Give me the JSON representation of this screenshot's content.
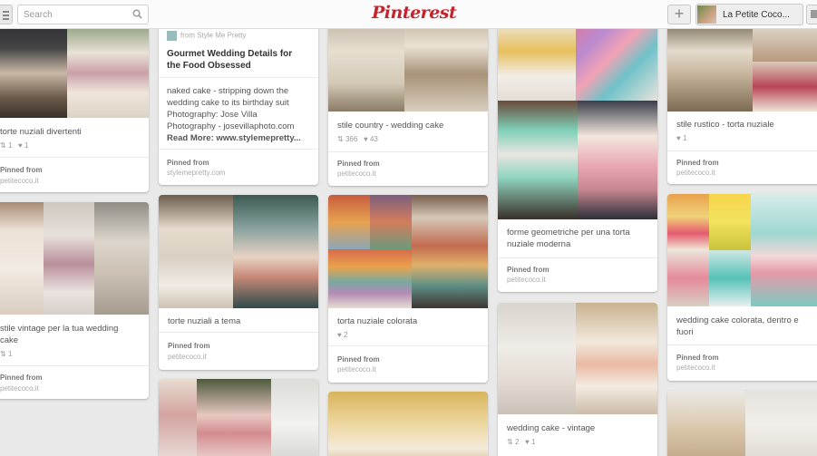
{
  "header": {
    "search_placeholder": "Search",
    "logo": "Pinterest",
    "add_label": "+",
    "user_name": "La Petite Coco..."
  },
  "pins": {
    "p1": {
      "desc": "torte nuziali divertenti",
      "repins": "1",
      "likes": "1",
      "pinned_label": "Pinned from",
      "source": "petitecoco.it"
    },
    "p2": {
      "desc": "stile vintage per la tua wedding",
      "desc2": "cake",
      "repins": "1",
      "pinned_label": "Pinned from",
      "source": "petitecoco.it"
    },
    "p3": {
      "via": "from Style Me Pretty",
      "title": "Gourmet Wedding Details for",
      "title2": "the Food Obsessed",
      "desc1": "naked cake - stripping down the",
      "desc2": "wedding cake to its birthday suit",
      "desc3": "Photography: Jose Villa",
      "desc4": "Photography - josevillaphoto.com",
      "desc5": "Read More: www.stylemepretty...",
      "pinned_label": "Pinned from",
      "source": "stylemepretty.com"
    },
    "p4": {
      "desc": "torte nuziali a tema",
      "pinned_label": "Pinned from",
      "source": "petitecoco.it"
    },
    "p5": {
      "desc": "stile country - wedding cake",
      "repins": "366",
      "likes": "43",
      "pinned_label": "Pinned from",
      "source": "petitecoco.it"
    },
    "p6": {
      "desc": "torta nuziale colorata",
      "likes": "2",
      "pinned_label": "Pinned from",
      "source": "petitecoco.it"
    },
    "p7": {
      "desc1": "forme geometriche per una torta",
      "desc2": "nuziale moderna",
      "pinned_label": "Pinned from",
      "source": "petitecoco.it"
    },
    "p8": {
      "desc": "wedding cake - vintage",
      "repins": "2",
      "likes": "1"
    },
    "p9": {
      "desc": "stile rustico - torta nuziale",
      "likes": "1",
      "pinned_label": "Pinned from",
      "source": "petitecoco.it"
    },
    "p10": {
      "desc1": "wedding cake colorata, dentro e",
      "desc2": "fuori",
      "pinned_label": "Pinned from",
      "source": "petitecoco.it"
    }
  },
  "colors": {
    "brand": "#c8232c",
    "background": "#e9e9e9"
  }
}
